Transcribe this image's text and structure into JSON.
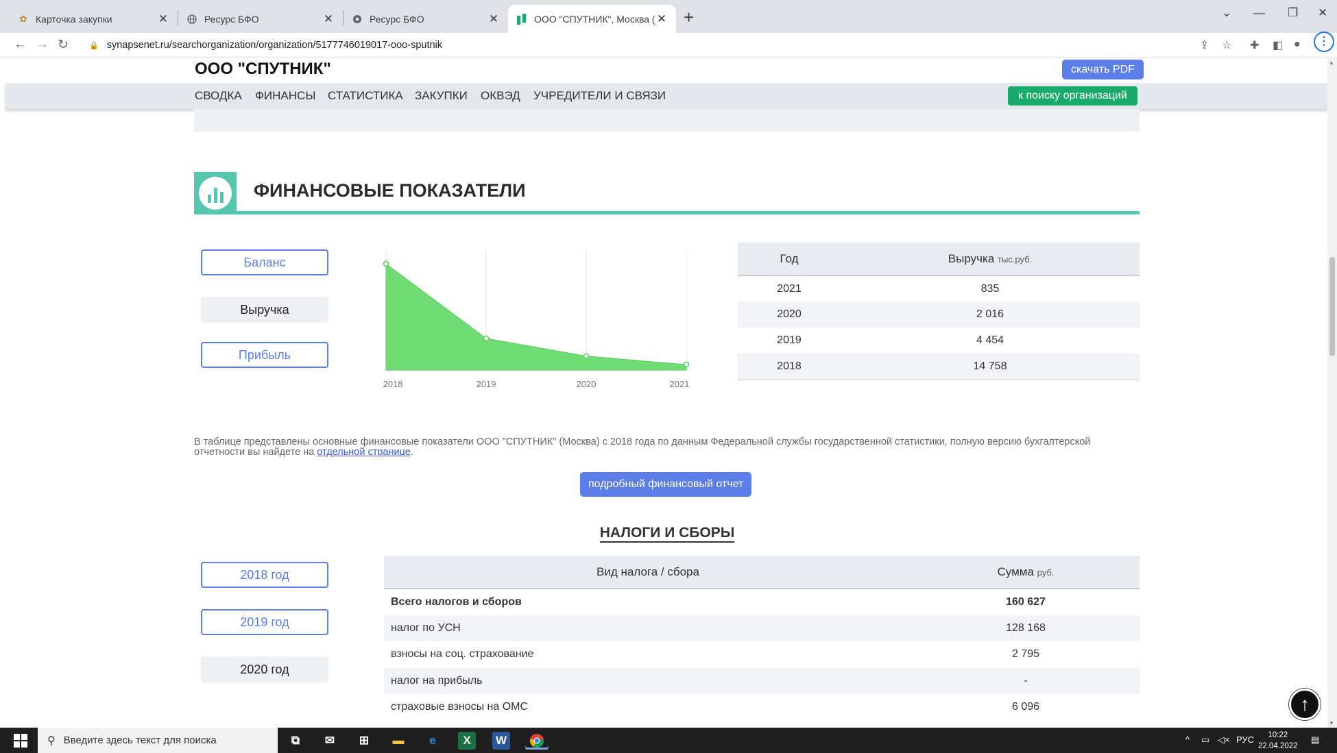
{
  "browser": {
    "tabs": [
      {
        "title": "Карточка закупки",
        "icon": "emblem-icon"
      },
      {
        "title": "Ресурс БФО",
        "icon": "globe-icon"
      },
      {
        "title": "Ресурс БФО",
        "icon": "globe-icon"
      },
      {
        "title": "ООО \"СПУТНИК\", Москва (ИНН",
        "icon": "synapsenet-icon"
      }
    ],
    "url": "synapsenet.ru/searchorganization/organization/5177746019017-ooo-sputnik"
  },
  "header": {
    "company": "ООО \"СПУТНИК\"",
    "pdf_button": "скачать PDF",
    "nav": [
      "СВОДКА",
      "ФИНАНСЫ",
      "СТАТИСТИКА",
      "ЗАКУПКИ",
      "ОКВЭД",
      "УЧРЕДИТЕЛИ И СВЯЗИ"
    ],
    "back_button": "к поиску организаций"
  },
  "finance": {
    "title": "ФИНАНСОВЫЕ ПОКАЗАТЕЛИ",
    "buttons": [
      "Баланс",
      "Выручка",
      "Прибыль"
    ],
    "table": {
      "col_year": "Год",
      "col_revenue": "Выручка",
      "col_unit": "тыс.руб.",
      "rows": [
        {
          "year": "2021",
          "value": "835"
        },
        {
          "year": "2020",
          "value": "2 016"
        },
        {
          "year": "2019",
          "value": "4 454"
        },
        {
          "year": "2018",
          "value": "14 758"
        }
      ]
    },
    "description_pre": "В таблице представлены основные финансовые показатели ООО \"СПУТНИК\" (Москва) с 2018 года по данным Федеральной службы государственной статистики, полную версию бухгалтерской отчетности вы найдете на ",
    "description_link": "отдельной странице",
    "description_post": ".",
    "report_button": "подробный финансовый отчет"
  },
  "chart_data": {
    "type": "area",
    "x": [
      "2018",
      "2019",
      "2020",
      "2021"
    ],
    "values": [
      14758,
      4454,
      2016,
      835
    ],
    "color": "#6fdc74",
    "grid": true
  },
  "taxes": {
    "title": "НАЛОГИ И СБОРЫ",
    "year_buttons": [
      "2018 год",
      "2019 год",
      "2020 год"
    ],
    "col_name": "Вид налога / сбора",
    "col_sum": "Сумма",
    "col_unit": "руб.",
    "rows": [
      {
        "name": "Всего налогов и сборов",
        "sum": "160 627"
      },
      {
        "name": "налог по УСН",
        "sum": "128 168"
      },
      {
        "name": "взносы на соц. страхование",
        "sum": "2 795"
      },
      {
        "name": "налог на прибыль",
        "sum": "-"
      },
      {
        "name": "страховые взносы на ОМС",
        "sum": "6 096"
      }
    ]
  },
  "taskbar": {
    "search_placeholder": "Введите здесь текст для поиска",
    "lang": "РУС",
    "time": "10:22",
    "date": "22.04.2022"
  },
  "colors": {
    "accent": "#5b7ee8",
    "green_button": "#1aaa6a",
    "section_teal": "#56c7ae",
    "chart_fill": "#6fdc74"
  }
}
